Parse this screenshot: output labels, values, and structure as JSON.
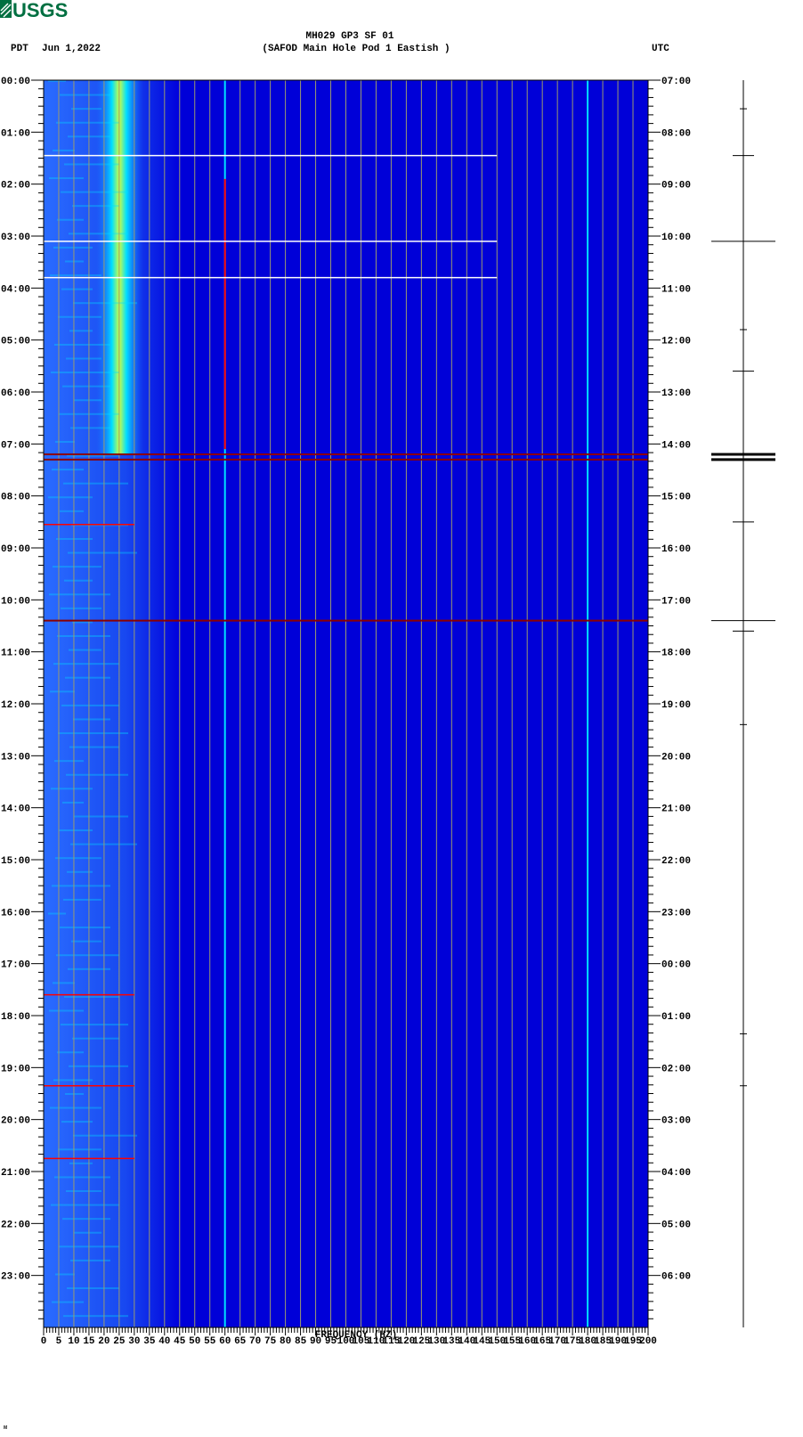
{
  "header": {
    "logo_text": "USGS",
    "station": "MH029 GP3 SF 01",
    "location": "(SAFOD Main Hole Pod 1 Eastish )",
    "left_timezone": "PDT",
    "date": "Jun 1,2022",
    "right_timezone": "UTC",
    "footer_mark": "ᴍ"
  },
  "chart_data": {
    "type": "heatmap",
    "title": "MH029 GP3 SF 01 (SAFOD Main Hole Pod 1 Eastish )",
    "xlabel": "FREQUENCY (HZ)",
    "xlim": [
      0,
      200
    ],
    "x_ticks": [
      "0",
      "5",
      "10",
      "15",
      "20",
      "25",
      "30",
      "35",
      "40",
      "45",
      "50",
      "55",
      "60",
      "65",
      "70",
      "75",
      "80",
      "85",
      "90",
      "95",
      "100",
      "105",
      "110",
      "115",
      "120",
      "125",
      "130",
      "135",
      "140",
      "145",
      "150",
      "155",
      "160",
      "165",
      "170",
      "175",
      "180",
      "185",
      "190",
      "195",
      "200"
    ],
    "ylim_hours": [
      0,
      24
    ],
    "y_left_ticks": [
      "00:00",
      "01:00",
      "02:00",
      "03:00",
      "04:00",
      "05:00",
      "06:00",
      "07:00",
      "08:00",
      "09:00",
      "10:00",
      "11:00",
      "12:00",
      "13:00",
      "14:00",
      "15:00",
      "16:00",
      "17:00",
      "18:00",
      "19:00",
      "20:00",
      "21:00",
      "22:00",
      "23:00"
    ],
    "y_right_ticks": [
      "07:00",
      "08:00",
      "09:00",
      "10:00",
      "11:00",
      "12:00",
      "13:00",
      "14:00",
      "15:00",
      "16:00",
      "17:00",
      "18:00",
      "19:00",
      "20:00",
      "21:00",
      "22:00",
      "23:00",
      "00:00",
      "01:00",
      "02:00",
      "03:00",
      "04:00",
      "05:00",
      "06:00"
    ],
    "grid": true,
    "colormap": [
      "#0000d8",
      "#1e5cff",
      "#00e0ff",
      "#ffff00",
      "#ff0000",
      "#8b0000"
    ],
    "persistent_lines_hz": [
      60,
      180
    ],
    "strong_band_hz": [
      20,
      30
    ],
    "strong_band_hours": [
      0,
      7.2
    ],
    "broadband_events_hours": [
      1.45,
      3.1,
      3.8,
      7.2,
      7.3,
      8.55,
      10.4,
      17.6,
      19.35,
      20.75
    ],
    "trace_events_hours": [
      0.55,
      1.45,
      3.1,
      4.8,
      5.6,
      7.2,
      7.3,
      8.5,
      10.4,
      10.6,
      12.4,
      18.35,
      19.35
    ]
  }
}
